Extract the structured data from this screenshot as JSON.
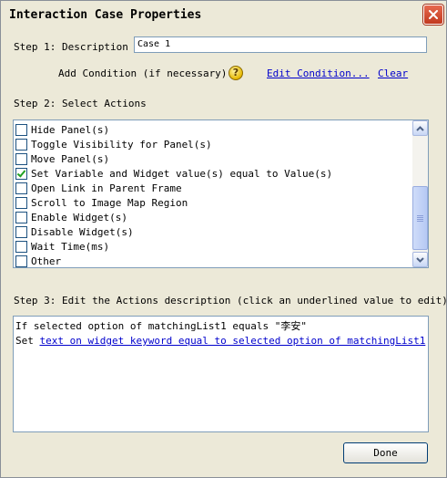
{
  "window": {
    "title": "Interaction Case Properties"
  },
  "step1": {
    "label": "Step 1: Description",
    "description_value": "Case 1",
    "add_condition_label": "Add Condition (if necessary)",
    "edit_condition_link": "Edit Condition...",
    "clear_link": "Clear"
  },
  "step2": {
    "label": "Step 2: Select Actions",
    "actions": [
      {
        "label": "Hide Panel(s)",
        "checked": false
      },
      {
        "label": "Toggle Visibility for Panel(s)",
        "checked": false
      },
      {
        "label": "Move Panel(s)",
        "checked": false
      },
      {
        "label": "Set Variable and Widget value(s) equal to Value(s)",
        "checked": true
      },
      {
        "label": "Open Link in Parent Frame",
        "checked": false
      },
      {
        "label": "Scroll to Image Map Region",
        "checked": false
      },
      {
        "label": "Enable Widget(s)",
        "checked": false
      },
      {
        "label": "Disable Widget(s)",
        "checked": false
      },
      {
        "label": "Wait Time(ms)",
        "checked": false
      },
      {
        "label": "Other",
        "checked": false
      }
    ]
  },
  "step3": {
    "label": "Step 3: Edit the Actions description (click an underlined value to edit):",
    "line1": "If selected option of matchingList1 equals \"李安\"",
    "line2_prefix": "Set ",
    "line2_link": "text on widget keyword equal to selected option of matchingList1"
  },
  "footer": {
    "done_label": "Done"
  },
  "icons": {
    "close": "close-icon",
    "help": "help-icon",
    "scroll_up": "chevron-up-icon",
    "scroll_down": "chevron-down-icon"
  },
  "colors": {
    "link": "#0000cc",
    "close_button": "#c1391f",
    "check": "#21a121"
  }
}
